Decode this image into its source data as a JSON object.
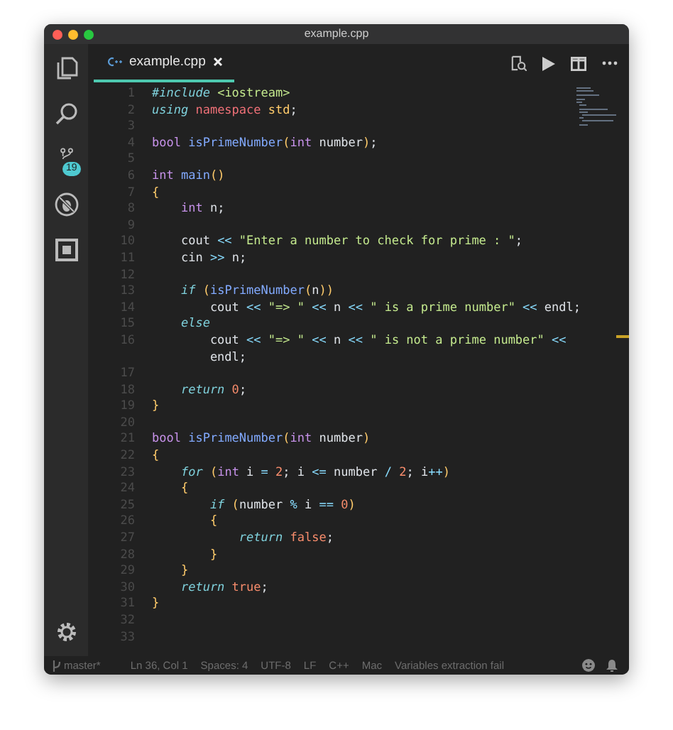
{
  "window": {
    "title": "example.cpp"
  },
  "activity_bar": {
    "scm_badge": "19"
  },
  "tabs": [
    {
      "label": "example.cpp",
      "selected": true
    }
  ],
  "code": [
    {
      "number": "1",
      "tokens": [
        {
          "kind": "kw",
          "text": "#include"
        },
        {
          "kind": "str",
          "text": " <iostream>"
        }
      ]
    },
    {
      "number": "2",
      "tokens": [
        {
          "kind": "kw",
          "text": "using"
        },
        {
          "kind": "ns",
          "text": " namespace"
        },
        {
          "kind": "cls",
          "text": " std"
        },
        {
          "kind": "plain",
          "text": ";"
        }
      ]
    },
    {
      "number": "3"
    },
    {
      "number": "4",
      "tokens": [
        {
          "kind": "type",
          "text": "bool"
        },
        {
          "kind": "fn",
          "text": " isPrimeNumber"
        },
        {
          "kind": "paren",
          "text": "("
        },
        {
          "kind": "type",
          "text": "int"
        },
        {
          "kind": "plain",
          "text": " number"
        },
        {
          "kind": "paren",
          "text": ")"
        },
        {
          "kind": "plain",
          "text": ";"
        }
      ]
    },
    {
      "number": "5"
    },
    {
      "number": "6",
      "tokens": [
        {
          "kind": "type",
          "text": "int"
        },
        {
          "kind": "fn",
          "text": " main"
        },
        {
          "kind": "paren",
          "text": "()"
        }
      ]
    },
    {
      "number": "7",
      "tokens": [
        {
          "kind": "paren",
          "text": "{"
        }
      ]
    },
    {
      "number": "8",
      "tokens": [
        {
          "kind": "type",
          "text": "    int"
        },
        {
          "kind": "plain",
          "text": " n;"
        }
      ]
    },
    {
      "number": "9"
    },
    {
      "number": "10",
      "tokens": [
        {
          "kind": "plain",
          "text": "    cout "
        },
        {
          "kind": "op",
          "text": "<<"
        },
        {
          "kind": "str",
          "text": " \"Enter a number to check for prime : \""
        },
        {
          "kind": "plain",
          "text": ";"
        }
      ]
    },
    {
      "number": "11",
      "tokens": [
        {
          "kind": "plain",
          "text": "    cin "
        },
        {
          "kind": "op",
          "text": ">>"
        },
        {
          "kind": "plain",
          "text": " n;"
        }
      ]
    },
    {
      "number": "12"
    },
    {
      "number": "13",
      "tokens": [
        {
          "kind": "kw",
          "text": "    if"
        },
        {
          "kind": "paren",
          "text": " ("
        },
        {
          "kind": "fn",
          "text": "isPrimeNumber"
        },
        {
          "kind": "paren",
          "text": "("
        },
        {
          "kind": "plain",
          "text": "n"
        },
        {
          "kind": "paren",
          "text": "))"
        }
      ]
    },
    {
      "number": "14",
      "tokens": [
        {
          "kind": "plain",
          "text": "        cout "
        },
        {
          "kind": "op",
          "text": "<<"
        },
        {
          "kind": "str",
          "text": " \"=> \""
        },
        {
          "kind": "op",
          "text": " <<"
        },
        {
          "kind": "plain",
          "text": " n "
        },
        {
          "kind": "op",
          "text": "<<"
        },
        {
          "kind": "str",
          "text": " \" is a prime number\""
        },
        {
          "kind": "op",
          "text": " <<"
        },
        {
          "kind": "plain",
          "text": " endl;"
        }
      ]
    },
    {
      "number": "15",
      "tokens": [
        {
          "kind": "kw",
          "text": "    else"
        }
      ]
    },
    {
      "number": "16",
      "tokens": [
        {
          "kind": "plain",
          "text": "        cout "
        },
        {
          "kind": "op",
          "text": "<<"
        },
        {
          "kind": "str",
          "text": " \"=> \""
        },
        {
          "kind": "op",
          "text": " <<"
        },
        {
          "kind": "plain",
          "text": " n "
        },
        {
          "kind": "op",
          "text": "<<"
        },
        {
          "kind": "str",
          "text": " \" is not a prime number\""
        },
        {
          "kind": "op",
          "text": " <<"
        }
      ],
      "wrapped": [
        {
          "kind": "plain",
          "text": "        endl;"
        }
      ]
    },
    {
      "number": "17"
    },
    {
      "number": "18",
      "tokens": [
        {
          "kind": "kw",
          "text": "    return"
        },
        {
          "kind": "num",
          "text": " 0"
        },
        {
          "kind": "plain",
          "text": ";"
        }
      ]
    },
    {
      "number": "19",
      "tokens": [
        {
          "kind": "paren",
          "text": "}"
        }
      ]
    },
    {
      "number": "20"
    },
    {
      "number": "21",
      "tokens": [
        {
          "kind": "type",
          "text": "bool"
        },
        {
          "kind": "fn",
          "text": " isPrimeNumber"
        },
        {
          "kind": "paren",
          "text": "("
        },
        {
          "kind": "type",
          "text": "int"
        },
        {
          "kind": "plain",
          "text": " number"
        },
        {
          "kind": "paren",
          "text": ")"
        }
      ]
    },
    {
      "number": "22",
      "tokens": [
        {
          "kind": "paren",
          "text": "{"
        }
      ]
    },
    {
      "number": "23",
      "tokens": [
        {
          "kind": "kw",
          "text": "    for"
        },
        {
          "kind": "paren",
          "text": " ("
        },
        {
          "kind": "type",
          "text": "int"
        },
        {
          "kind": "plain",
          "text": " i "
        },
        {
          "kind": "op",
          "text": "="
        },
        {
          "kind": "num",
          "text": " 2"
        },
        {
          "kind": "plain",
          "text": "; i "
        },
        {
          "kind": "op",
          "text": "<="
        },
        {
          "kind": "plain",
          "text": " number "
        },
        {
          "kind": "op",
          "text": "/"
        },
        {
          "kind": "num",
          "text": " 2"
        },
        {
          "kind": "plain",
          "text": "; i"
        },
        {
          "kind": "op",
          "text": "++"
        },
        {
          "kind": "paren",
          "text": ")"
        }
      ]
    },
    {
      "number": "24",
      "tokens": [
        {
          "kind": "paren",
          "text": "    {"
        }
      ]
    },
    {
      "number": "25",
      "tokens": [
        {
          "kind": "kw",
          "text": "        if"
        },
        {
          "kind": "paren",
          "text": " ("
        },
        {
          "kind": "plain",
          "text": "number "
        },
        {
          "kind": "op",
          "text": "%"
        },
        {
          "kind": "plain",
          "text": " i "
        },
        {
          "kind": "op",
          "text": "=="
        },
        {
          "kind": "num",
          "text": " 0"
        },
        {
          "kind": "paren",
          "text": ")"
        }
      ]
    },
    {
      "number": "26",
      "tokens": [
        {
          "kind": "paren",
          "text": "        {"
        }
      ]
    },
    {
      "number": "27",
      "tokens": [
        {
          "kind": "kw",
          "text": "            return"
        },
        {
          "kind": "num",
          "text": " false"
        },
        {
          "kind": "plain",
          "text": ";"
        }
      ]
    },
    {
      "number": "28",
      "tokens": [
        {
          "kind": "paren",
          "text": "        }"
        }
      ]
    },
    {
      "number": "29",
      "tokens": [
        {
          "kind": "paren",
          "text": "    }"
        }
      ]
    },
    {
      "number": "30",
      "tokens": [
        {
          "kind": "kw",
          "text": "    return"
        },
        {
          "kind": "num",
          "text": " true"
        },
        {
          "kind": "plain",
          "text": ";"
        }
      ]
    },
    {
      "number": "31",
      "tokens": [
        {
          "kind": "paren",
          "text": "}"
        }
      ]
    },
    {
      "number": "32"
    },
    {
      "number": "33"
    }
  ],
  "status_bar": {
    "branch": "master*",
    "items": [
      "Ln 36, Col 1",
      "Spaces: 4",
      "UTF-8",
      "LF",
      "C++",
      "Mac",
      "Variables extraction fail"
    ]
  }
}
